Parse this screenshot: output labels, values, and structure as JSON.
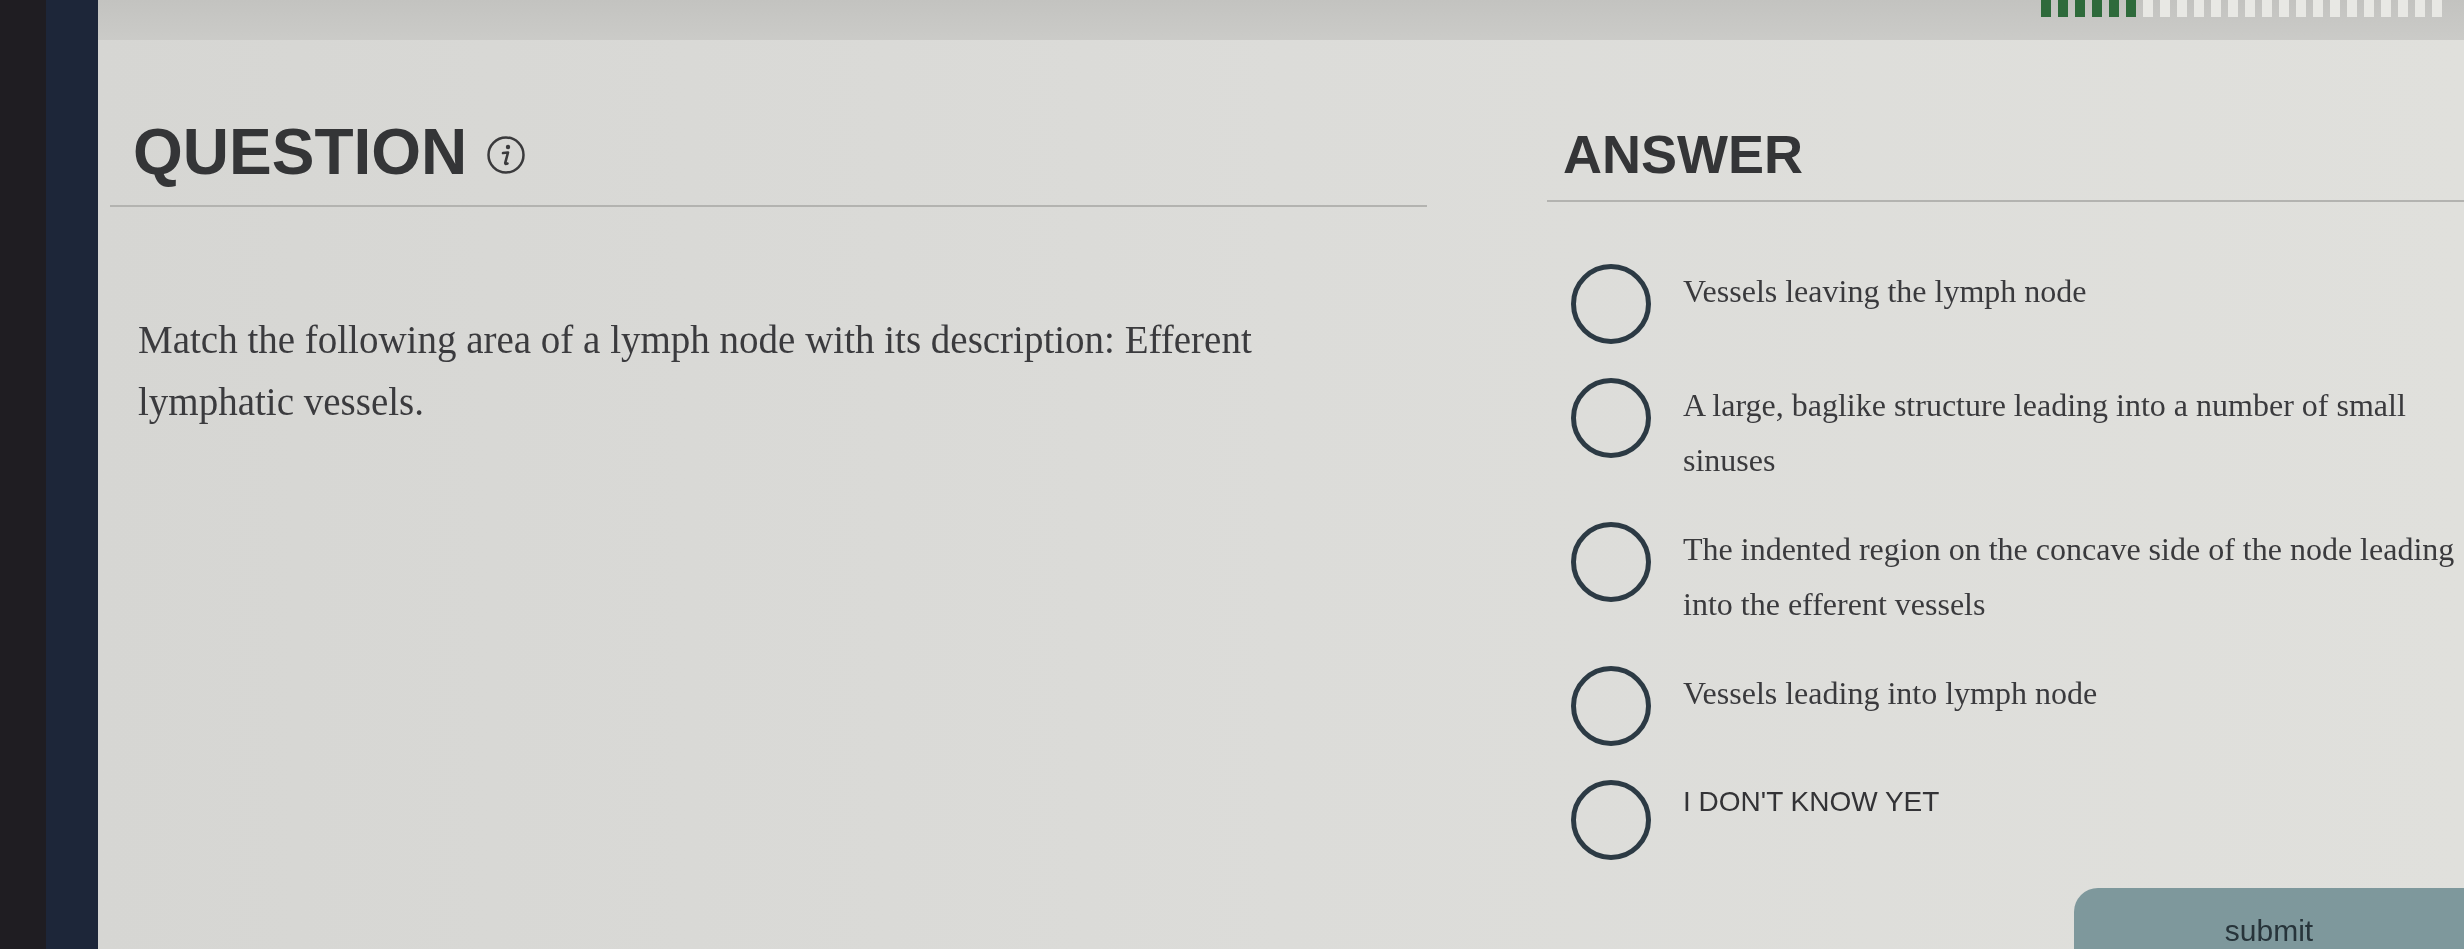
{
  "progress": {
    "level": 0.25
  },
  "question": {
    "heading": "QUESTION",
    "text": "Match the following area of a lymph node with its description: Efferent lymphatic vessels."
  },
  "answer": {
    "heading": "ANSWER",
    "options": [
      {
        "kind": "choice",
        "label": "Vessels leaving the lymph node",
        "selected": false
      },
      {
        "kind": "choice",
        "label": "A large, baglike structure leading into a number of small sinuses",
        "selected": false
      },
      {
        "kind": "choice",
        "label": "The indented region on the concave side of the node leading into the efferent vessels",
        "selected": false
      },
      {
        "kind": "choice",
        "label": "Vessels leading into lymph node",
        "selected": false
      },
      {
        "kind": "dont_know",
        "label": "I DON'T KNOW YET",
        "selected": false
      }
    ]
  },
  "submit": {
    "label": "submit"
  }
}
